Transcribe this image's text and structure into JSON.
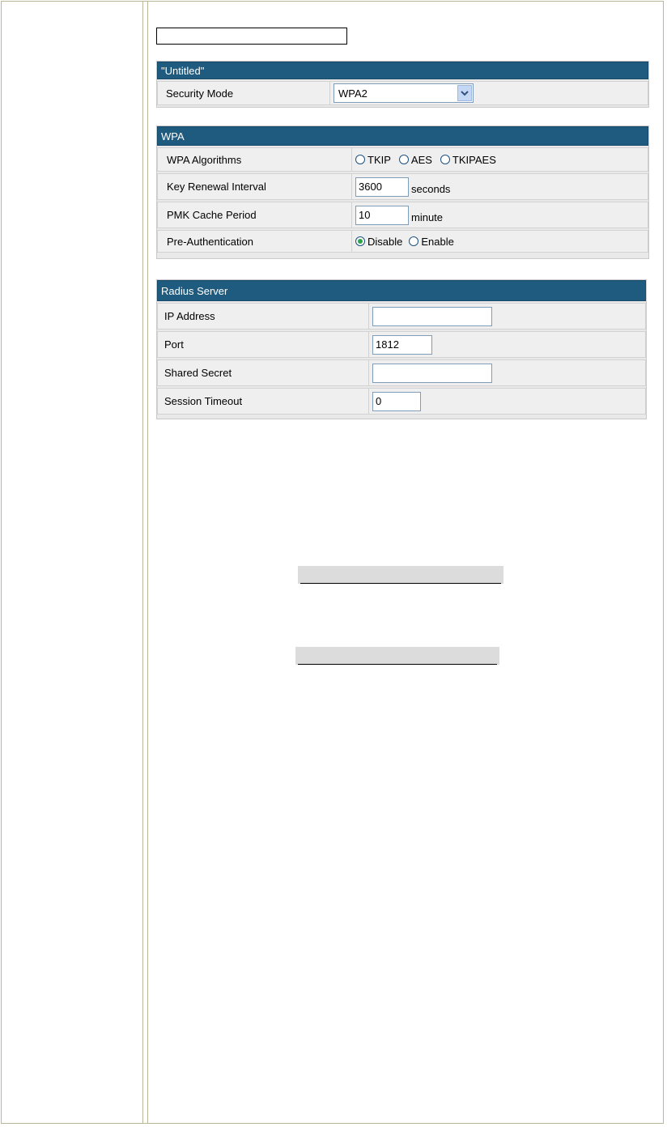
{
  "security_section": {
    "title": "\"Untitled\"",
    "security_mode_label": "Security Mode",
    "security_mode_value": "WPA2"
  },
  "wpa_section": {
    "title": "WPA",
    "algorithms_label": "WPA Algorithms",
    "algorithms": [
      {
        "label": "TKIP",
        "selected": false
      },
      {
        "label": "AES",
        "selected": false
      },
      {
        "label": "TKIPAES",
        "selected": false
      }
    ],
    "key_renewal_label": "Key Renewal Interval",
    "key_renewal_value": "3600",
    "key_renewal_unit": "seconds",
    "pmk_label": "PMK Cache Period",
    "pmk_value": "10",
    "pmk_unit": "minute",
    "preauth_label": "Pre-Authentication",
    "preauth_options": [
      {
        "label": "Disable",
        "selected": true
      },
      {
        "label": "Enable",
        "selected": false
      }
    ]
  },
  "radius_section": {
    "title": "Radius Server",
    "ip_label": "IP Address",
    "ip_value": "",
    "port_label": "Port",
    "port_value": "1812",
    "secret_label": "Shared Secret",
    "secret_value": "",
    "timeout_label": "Session Timeout",
    "timeout_value": "0"
  },
  "colors": {
    "header_bg": "#1f5b7e",
    "row_bg": "#efefef",
    "frame": "#b8b79a"
  }
}
